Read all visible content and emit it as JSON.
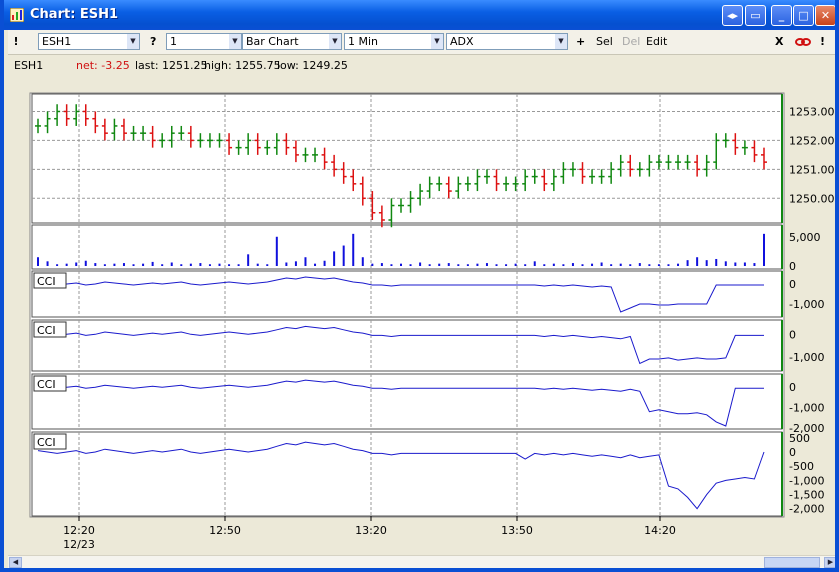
{
  "window": {
    "title": "Chart: ESH1",
    "controls": [
      "◂▸",
      "▭",
      "_",
      "□",
      "✕"
    ]
  },
  "toolbar": {
    "grip_label": "!",
    "symbol": "ESH1",
    "help_label": "?",
    "interval_value": "1",
    "chart_type": "Bar Chart",
    "timeframe": "1 Min",
    "indicator": "ADX",
    "add_label": "+",
    "sel_label": "Sel",
    "del_label": "Del",
    "edit_label": "Edit",
    "close_label": "X",
    "alert_label": "!"
  },
  "info": {
    "symbol": "ESH1",
    "net": "net: -3.25",
    "last": "last: 1251.25",
    "high": "high: 1255.75",
    "low": "low: 1249.25"
  },
  "colors": {
    "up": "#118811",
    "down": "#dd1111",
    "line": "#1a1acc",
    "volume": "#1010dd",
    "axis": "#118811"
  },
  "chart_data": {
    "type": "line",
    "x_ticks": [
      "12:20",
      "12:50",
      "13:20",
      "13:50",
      "14:20"
    ],
    "x_date": "12/23",
    "price": {
      "ylim": [
        1249.25,
        1253.5
      ],
      "y_ticks": [
        "1253.00",
        "1252.00",
        "1251.00",
        "1250.00"
      ],
      "values": [
        1252.5,
        1252.75,
        1253.0,
        1252.75,
        1253.0,
        1252.75,
        1252.5,
        1252.25,
        1252.5,
        1252.25,
        1252.25,
        1252.25,
        1252.0,
        1252.0,
        1252.25,
        1252.25,
        1252.0,
        1252.0,
        1252.0,
        1252.0,
        1251.75,
        1251.75,
        1252.0,
        1251.75,
        1251.75,
        1252.0,
        1251.75,
        1251.5,
        1251.5,
        1251.5,
        1251.25,
        1251.0,
        1250.75,
        1250.5,
        1250.0,
        1249.5,
        1249.25,
        1249.75,
        1249.75,
        1250.0,
        1250.25,
        1250.5,
        1250.5,
        1250.25,
        1250.5,
        1250.5,
        1250.75,
        1250.75,
        1250.5,
        1250.5,
        1250.5,
        1250.75,
        1250.75,
        1250.5,
        1250.75,
        1251.0,
        1251.0,
        1250.75,
        1250.75,
        1250.75,
        1251.0,
        1251.25,
        1251.0,
        1251.0,
        1251.25,
        1251.25,
        1251.25,
        1251.25,
        1251.25,
        1251.0,
        1251.25,
        1252.0,
        1252.0,
        1251.75,
        1251.75,
        1251.5,
        1251.25
      ]
    },
    "volume": {
      "ylim": [
        0,
        6500
      ],
      "y_ticks": [
        "5,000",
        "0"
      ],
      "values": [
        1500,
        800,
        300,
        400,
        600,
        900,
        500,
        300,
        400,
        500,
        300,
        400,
        700,
        300,
        600,
        300,
        400,
        500,
        300,
        400,
        300,
        300,
        2000,
        400,
        300,
        5000,
        600,
        800,
        1500,
        400,
        900,
        2500,
        3500,
        5500,
        1500,
        400,
        500,
        300,
        400,
        300,
        600,
        300,
        400,
        500,
        300,
        300,
        400,
        500,
        300,
        300,
        400,
        300,
        800,
        300,
        400,
        300,
        500,
        300,
        400,
        600,
        300,
        400,
        300,
        500,
        300,
        300,
        300,
        400,
        1000,
        1500,
        1000,
        1200,
        800,
        600,
        600,
        500,
        5500
      ]
    },
    "cci_panels": [
      {
        "label": "CCI",
        "ylim": [
          -1500,
          500
        ],
        "y_ticks": [
          "0",
          "-1,000"
        ],
        "values": [
          50,
          0,
          -50,
          0,
          50,
          -50,
          0,
          100,
          50,
          0,
          -50,
          0,
          50,
          0,
          50,
          100,
          0,
          -50,
          0,
          50,
          100,
          50,
          0,
          50,
          100,
          200,
          300,
          250,
          350,
          300,
          250,
          300,
          200,
          100,
          50,
          -50,
          -50,
          -100,
          -50,
          -50,
          -50,
          -50,
          -50,
          -50,
          -50,
          -50,
          -50,
          -50,
          -50,
          -50,
          -50,
          -50,
          -50,
          -100,
          -50,
          -100,
          -50,
          -100,
          -150,
          -100,
          -150,
          -1400,
          -1200,
          -1000,
          -1000,
          -1050,
          -1050,
          -1000,
          -1000,
          -1000,
          -1000,
          -50,
          -50,
          -50,
          -50,
          -50,
          -50
        ]
      },
      {
        "label": "CCI",
        "ylim": [
          -1500,
          500
        ],
        "y_ticks": [
          "0",
          "-1,000"
        ],
        "values": [
          50,
          0,
          -50,
          0,
          50,
          -50,
          0,
          100,
          50,
          0,
          -50,
          0,
          50,
          0,
          50,
          100,
          0,
          -50,
          0,
          50,
          100,
          50,
          0,
          50,
          100,
          200,
          300,
          250,
          350,
          300,
          250,
          300,
          200,
          100,
          50,
          -50,
          -50,
          -100,
          -50,
          -50,
          -50,
          -50,
          -50,
          -50,
          -50,
          -50,
          -50,
          -50,
          -50,
          -50,
          -50,
          -50,
          -50,
          -100,
          -50,
          -100,
          -50,
          -100,
          -150,
          -100,
          -150,
          -200,
          -100,
          -1300,
          -1100,
          -1100,
          -1050,
          -1150,
          -1100,
          -1050,
          -1100,
          -1100,
          -1050,
          -50,
          -50,
          -50,
          -50
        ]
      },
      {
        "label": "CCI",
        "ylim": [
          -1900,
          500
        ],
        "y_ticks": [
          "0",
          "-1,000",
          "-2,000"
        ],
        "values": [
          50,
          0,
          -50,
          0,
          50,
          -50,
          0,
          100,
          50,
          0,
          -50,
          0,
          50,
          0,
          50,
          100,
          0,
          -50,
          0,
          50,
          100,
          50,
          0,
          50,
          100,
          200,
          300,
          250,
          350,
          300,
          250,
          300,
          200,
          100,
          50,
          -50,
          -50,
          -100,
          -50,
          -50,
          -50,
          -50,
          -50,
          -50,
          -50,
          -50,
          -50,
          -50,
          -50,
          -50,
          -50,
          -50,
          -50,
          -100,
          -50,
          -100,
          -50,
          -100,
          -150,
          -100,
          -150,
          -200,
          -100,
          -200,
          -1200,
          -1100,
          -1200,
          -1300,
          -1300,
          -1250,
          -1350,
          -1700,
          -1900,
          -50,
          -50,
          -50,
          -50
        ]
      },
      {
        "label": "CCI",
        "ylim": [
          -2150,
          600
        ],
        "y_ticks": [
          "500",
          "0",
          "-500",
          "-1,000",
          "-1,500",
          "-2,000"
        ],
        "values": [
          50,
          0,
          -50,
          0,
          50,
          -50,
          0,
          100,
          50,
          0,
          -50,
          0,
          50,
          0,
          50,
          100,
          0,
          -50,
          0,
          50,
          100,
          50,
          0,
          50,
          100,
          200,
          300,
          250,
          350,
          300,
          250,
          300,
          200,
          100,
          50,
          -50,
          -50,
          -100,
          -50,
          -50,
          -50,
          -50,
          -50,
          -50,
          -50,
          -50,
          -50,
          -50,
          -50,
          -50,
          -50,
          -250,
          -50,
          -100,
          -50,
          -100,
          -50,
          -100,
          -150,
          -100,
          -150,
          -200,
          -100,
          -200,
          -150,
          -100,
          -1200,
          -1300,
          -1600,
          -2000,
          -1500,
          -1100,
          -1000,
          -950,
          -900,
          -950,
          0
        ]
      }
    ]
  }
}
